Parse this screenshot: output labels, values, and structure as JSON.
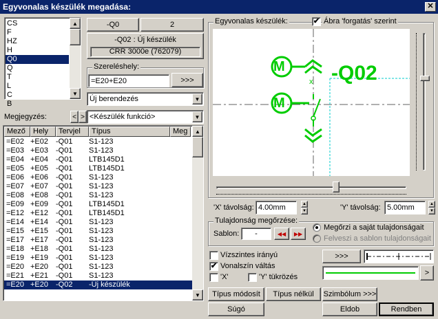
{
  "window": {
    "title": "Egyvonalas készülék megadása:",
    "close": "✕"
  },
  "code_list": {
    "items": [
      "CS",
      "F",
      "HZ",
      "H",
      "Q0",
      "Q",
      "T",
      "L",
      "C",
      "B"
    ],
    "selected": 4
  },
  "device_header": {
    "btn_q0": "-Q0",
    "btn_2": "2",
    "device_name": "-Q02  :  Új készülék",
    "device_type": "CRR 3000e (762079)"
  },
  "location": {
    "label": "Szereléshely:",
    "value": "=E20+E20",
    "browse": ">>>"
  },
  "berendezes": {
    "value": "Új berendezés"
  },
  "note": {
    "label": "Megjegyzés:",
    "prev": "<",
    "next": ">",
    "function_value": "<Készülék funkció>"
  },
  "table": {
    "headers": [
      "Mező",
      "Hely",
      "Tervjel",
      "Típus",
      "Meg"
    ],
    "rows": [
      [
        "=E02",
        "+E02",
        "-Q01",
        "S1-123"
      ],
      [
        "=E03",
        "+E03",
        "-Q01",
        "S1-123"
      ],
      [
        "=E04",
        "+E04",
        "-Q01",
        "LTB145D1"
      ],
      [
        "=E05",
        "+E05",
        "-Q01",
        "LTB145D1"
      ],
      [
        "=E06",
        "+E06",
        "-Q01",
        "S1-123"
      ],
      [
        "=E07",
        "+E07",
        "-Q01",
        "S1-123"
      ],
      [
        "=E08",
        "+E08",
        "-Q01",
        "S1-123"
      ],
      [
        "=E09",
        "+E09",
        "-Q01",
        "LTB145D1"
      ],
      [
        "=E12",
        "+E12",
        "-Q01",
        "LTB145D1"
      ],
      [
        "=E14",
        "+E14",
        "-Q01",
        "S1-123"
      ],
      [
        "=E15",
        "+E15",
        "-Q01",
        "S1-123"
      ],
      [
        "=E17",
        "+E17",
        "-Q01",
        "S1-123"
      ],
      [
        "=E18",
        "+E18",
        "-Q01",
        "S1-123"
      ],
      [
        "=E19",
        "+E19",
        "-Q01",
        "S1-123"
      ],
      [
        "=E20",
        "+E20",
        "-Q01",
        "S1-123"
      ],
      [
        "=E21",
        "+E21",
        "-Q01",
        "S1-123"
      ],
      [
        "=E20",
        "+E20",
        "-Q02",
        "-Új készülék"
      ]
    ],
    "selected": 16
  },
  "preview": {
    "label": "Egyvonalas készülék:",
    "rotate_label": "Ábra 'forgatás' szerint",
    "rotate_checked": "✔",
    "symbol_m": "M",
    "symbol_tag": "-Q02",
    "symbol_x": "x"
  },
  "distance": {
    "x_label": "'X' távolság:",
    "x_value": "4.00mm",
    "y_label": "'Y' távolság:",
    "y_value": "5.00mm"
  },
  "properties": {
    "label": "Tulajdonság megőrzése:",
    "template_label": "Sablon:",
    "template_value": "-",
    "prev_icon": "◀◀",
    "next_icon": "▶▶",
    "radio1": "Megőrzi a saját tulajdonságait",
    "radio2": "Felveszi a sablon tulajdonságait"
  },
  "options": {
    "horizontal": "Vízszintes irányú",
    "horizontal_checked": "",
    "linecolor": "Vonalszín váltás",
    "linecolor_checked": "✔",
    "x_mirror": "'X'",
    "x_mirror_checked": "",
    "y_mirror": "'Y' tükrözés",
    "y_mirror_checked": "",
    "browse": ">>>",
    "line_more": ">"
  },
  "buttons": {
    "type_modify": "Típus módosít",
    "no_type": "Típus nélkül",
    "symbol": "Szimbólum >>>",
    "help": "Súgó",
    "delete": "Eldob",
    "ok": "Rendben"
  },
  "colors": {
    "symbol": "#00cc00",
    "title_bg": "#0a246a",
    "window_bg": "#d4d0c8"
  }
}
